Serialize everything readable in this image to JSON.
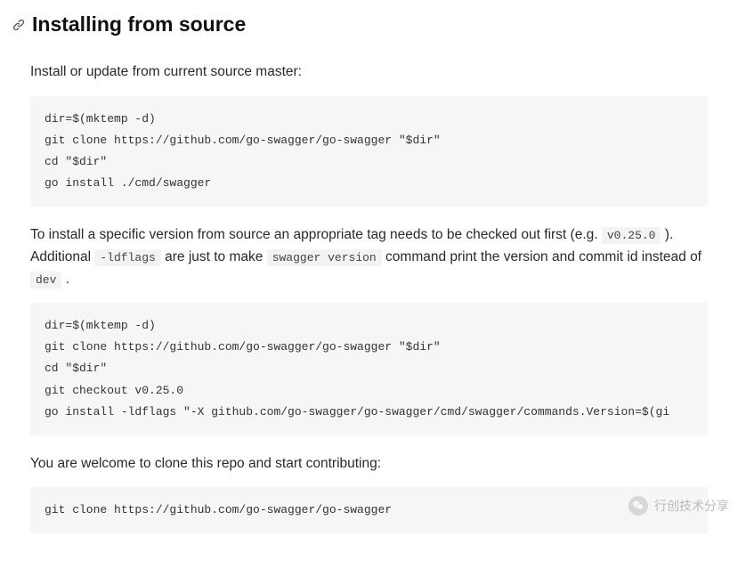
{
  "heading": "Installing from source",
  "para1": "Install or update from current source master:",
  "code1": "dir=$(mktemp -d)\ngit clone https://github.com/go-swagger/go-swagger \"$dir\"\ncd \"$dir\"\ngo install ./cmd/swagger",
  "para2a": "To install a specific version from source an appropriate tag needs to be checked out first (e.g. ",
  "para2_tag": "v0.25.0",
  "para2b": " ). Additional ",
  "para2_ldflags": "-ldflags",
  "para2c": " are just to make ",
  "para2_sv": "swagger version",
  "para2d": " command print the version and commit id instead of ",
  "para2_dev": "dev",
  "para2e": " .",
  "code2": "dir=$(mktemp -d)\ngit clone https://github.com/go-swagger/go-swagger \"$dir\"\ncd \"$dir\"\ngit checkout v0.25.0\ngo install -ldflags \"-X github.com/go-swagger/go-swagger/cmd/swagger/commands.Version=$(gi",
  "para3": "You are welcome to clone this repo and start contributing:",
  "code3": "git clone https://github.com/go-swagger/go-swagger",
  "watermark": "行创技术分享"
}
